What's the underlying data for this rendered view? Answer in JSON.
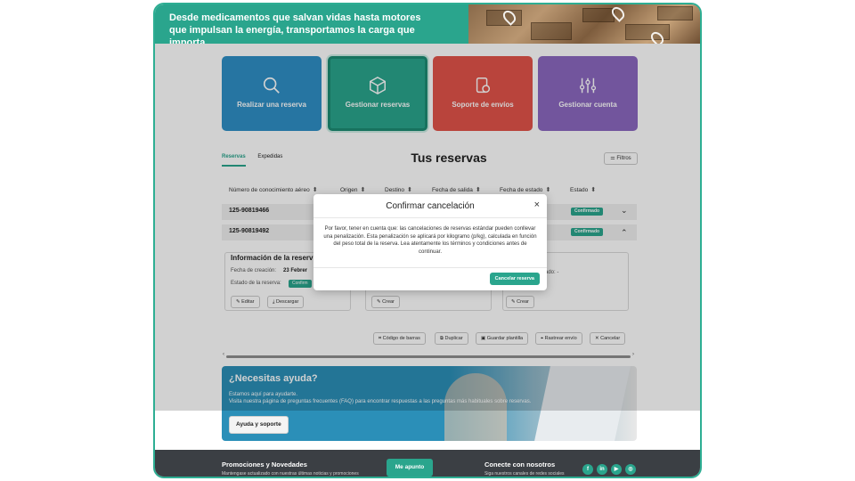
{
  "hero": {
    "text": "Desde medicamentos que salvan vidas hasta motores que impulsan la energía, transportamos la carga que importa."
  },
  "tiles": [
    {
      "label": "Realizar una reserva",
      "icon": "search-icon"
    },
    {
      "label": "Gestionar reservas",
      "icon": "box-icon"
    },
    {
      "label": "Soporte de envíos",
      "icon": "support-icon"
    },
    {
      "label": "Gestionar cuenta",
      "icon": "sliders-icon"
    }
  ],
  "tabs": [
    {
      "label": "Reservas",
      "active": true
    },
    {
      "label": "Expedidas",
      "active": false
    }
  ],
  "page_title": "Tus reservas",
  "filters_label": "Filtros",
  "columns": [
    "Número de conocimiento aéreo",
    "Origen",
    "Destino",
    "Fecha de salida",
    "Fecha de estado",
    "Estado"
  ],
  "rows": [
    {
      "code": "125-90819466",
      "status": "Confirmado"
    },
    {
      "code": "125-90819492",
      "status": "Confirmado"
    }
  ],
  "details": {
    "title": "Información de la reserv",
    "created_label": "Fecha de creación:",
    "created_value": "23 Febrer",
    "status_label": "Estado de la reserva:",
    "status_value": "Confirm",
    "third_card_label": "ado: -",
    "edit": "Editar",
    "download": "Descargar",
    "create": "Crear",
    "create2": "Crear"
  },
  "actions": {
    "barcode": "Código de barras",
    "duplicate": "Duplicar",
    "save_template": "Guardar plantilla",
    "track": "Rastrear envío",
    "cancel": "Cancelar"
  },
  "help": {
    "title": "¿Necesitas ayuda?",
    "line1": "Estamos aquí para ayudarte.",
    "line2": "Visita nuestra página de preguntas frecuentes (FAQ) para encontrar respuestas a las preguntas más habituales sobre reservas.",
    "button": "Ayuda y soporte"
  },
  "footer": {
    "promo_title": "Promociones y Novedades",
    "promo_sub": "Mantengase actualizado con nuestras últimas noticias y promociones",
    "subscribe": "Me apunto",
    "connect_title": "Conecte con nosotros",
    "connect_sub": "Siga nuestros canales de redes sociales",
    "social": [
      "f",
      "in",
      "▶",
      "◎"
    ]
  },
  "modal": {
    "title": "Confirmar cancelación",
    "body": "Por favor, tener en cuenta que: las cancelaciones de reservas estándar pueden conllevar una penalización. Esta penalización se aplicará por kilogramo (p/kg), calculada en función del peso total de la reserva. Lea atentamente los términos y condiciones antes de continuar.",
    "confirm": "Cancelar reserva",
    "close": "×"
  },
  "colors": {
    "accent": "#2aa58d",
    "blue": "#2f8fc6",
    "red": "#e2534a",
    "purple": "#8b68c0"
  }
}
